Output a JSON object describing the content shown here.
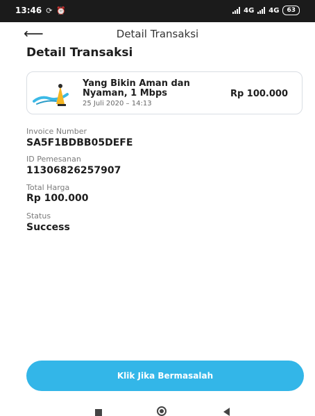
{
  "status_bar": {
    "time": "13:46",
    "network_text": "4G",
    "network_text_2": "4G",
    "battery": "63"
  },
  "header": {
    "title": "Detail Transaksi",
    "back_icon": "arrow-left-icon"
  },
  "page": {
    "title": "Detail Transaksi"
  },
  "product": {
    "name": "Yang Bikin Aman dan Nyaman, 1 Mbps",
    "date": "25 Juli 2020 – 14:13",
    "price": "Rp 100.000"
  },
  "fields": [
    {
      "label": "Invoice Number",
      "value": "SA5F1BDBB05DEFE"
    },
    {
      "label": "ID Pemesanan",
      "value": "11306826257907"
    },
    {
      "label": "Total Harga",
      "value": "Rp 100.000"
    },
    {
      "label": "Status",
      "value": "Success"
    }
  ],
  "cta": {
    "label": "Klik Jika Bermasalah"
  },
  "colors": {
    "accent": "#33b6e8",
    "status_bar_bg": "#1b1b1b"
  }
}
